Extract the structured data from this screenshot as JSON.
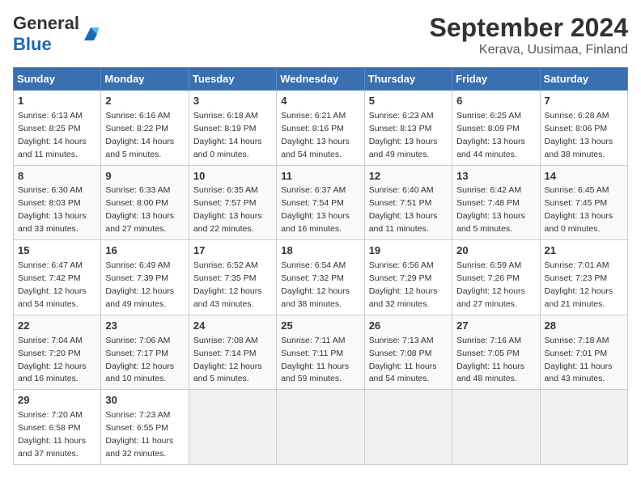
{
  "logo": {
    "general": "General",
    "blue": "Blue"
  },
  "title": "September 2024",
  "subtitle": "Kerava, Uusimaa, Finland",
  "days_of_week": [
    "Sunday",
    "Monday",
    "Tuesday",
    "Wednesday",
    "Thursday",
    "Friday",
    "Saturday"
  ],
  "weeks": [
    [
      {
        "day": "1",
        "sunrise": "6:13 AM",
        "sunset": "8:25 PM",
        "daylight": "14 hours and 11 minutes."
      },
      {
        "day": "2",
        "sunrise": "6:16 AM",
        "sunset": "8:22 PM",
        "daylight": "14 hours and 5 minutes."
      },
      {
        "day": "3",
        "sunrise": "6:18 AM",
        "sunset": "8:19 PM",
        "daylight": "14 hours and 0 minutes."
      },
      {
        "day": "4",
        "sunrise": "6:21 AM",
        "sunset": "8:16 PM",
        "daylight": "13 hours and 54 minutes."
      },
      {
        "day": "5",
        "sunrise": "6:23 AM",
        "sunset": "8:13 PM",
        "daylight": "13 hours and 49 minutes."
      },
      {
        "day": "6",
        "sunrise": "6:25 AM",
        "sunset": "8:09 PM",
        "daylight": "13 hours and 44 minutes."
      },
      {
        "day": "7",
        "sunrise": "6:28 AM",
        "sunset": "8:06 PM",
        "daylight": "13 hours and 38 minutes."
      }
    ],
    [
      {
        "day": "8",
        "sunrise": "6:30 AM",
        "sunset": "8:03 PM",
        "daylight": "13 hours and 33 minutes."
      },
      {
        "day": "9",
        "sunrise": "6:33 AM",
        "sunset": "8:00 PM",
        "daylight": "13 hours and 27 minutes."
      },
      {
        "day": "10",
        "sunrise": "6:35 AM",
        "sunset": "7:57 PM",
        "daylight": "13 hours and 22 minutes."
      },
      {
        "day": "11",
        "sunrise": "6:37 AM",
        "sunset": "7:54 PM",
        "daylight": "13 hours and 16 minutes."
      },
      {
        "day": "12",
        "sunrise": "6:40 AM",
        "sunset": "7:51 PM",
        "daylight": "13 hours and 11 minutes."
      },
      {
        "day": "13",
        "sunrise": "6:42 AM",
        "sunset": "7:48 PM",
        "daylight": "13 hours and 5 minutes."
      },
      {
        "day": "14",
        "sunrise": "6:45 AM",
        "sunset": "7:45 PM",
        "daylight": "13 hours and 0 minutes."
      }
    ],
    [
      {
        "day": "15",
        "sunrise": "6:47 AM",
        "sunset": "7:42 PM",
        "daylight": "12 hours and 54 minutes."
      },
      {
        "day": "16",
        "sunrise": "6:49 AM",
        "sunset": "7:39 PM",
        "daylight": "12 hours and 49 minutes."
      },
      {
        "day": "17",
        "sunrise": "6:52 AM",
        "sunset": "7:35 PM",
        "daylight": "12 hours and 43 minutes."
      },
      {
        "day": "18",
        "sunrise": "6:54 AM",
        "sunset": "7:32 PM",
        "daylight": "12 hours and 38 minutes."
      },
      {
        "day": "19",
        "sunrise": "6:56 AM",
        "sunset": "7:29 PM",
        "daylight": "12 hours and 32 minutes."
      },
      {
        "day": "20",
        "sunrise": "6:59 AM",
        "sunset": "7:26 PM",
        "daylight": "12 hours and 27 minutes."
      },
      {
        "day": "21",
        "sunrise": "7:01 AM",
        "sunset": "7:23 PM",
        "daylight": "12 hours and 21 minutes."
      }
    ],
    [
      {
        "day": "22",
        "sunrise": "7:04 AM",
        "sunset": "7:20 PM",
        "daylight": "12 hours and 16 minutes."
      },
      {
        "day": "23",
        "sunrise": "7:06 AM",
        "sunset": "7:17 PM",
        "daylight": "12 hours and 10 minutes."
      },
      {
        "day": "24",
        "sunrise": "7:08 AM",
        "sunset": "7:14 PM",
        "daylight": "12 hours and 5 minutes."
      },
      {
        "day": "25",
        "sunrise": "7:11 AM",
        "sunset": "7:11 PM",
        "daylight": "11 hours and 59 minutes."
      },
      {
        "day": "26",
        "sunrise": "7:13 AM",
        "sunset": "7:08 PM",
        "daylight": "11 hours and 54 minutes."
      },
      {
        "day": "27",
        "sunrise": "7:16 AM",
        "sunset": "7:05 PM",
        "daylight": "11 hours and 48 minutes."
      },
      {
        "day": "28",
        "sunrise": "7:18 AM",
        "sunset": "7:01 PM",
        "daylight": "11 hours and 43 minutes."
      }
    ],
    [
      {
        "day": "29",
        "sunrise": "7:20 AM",
        "sunset": "6:58 PM",
        "daylight": "11 hours and 37 minutes."
      },
      {
        "day": "30",
        "sunrise": "7:23 AM",
        "sunset": "6:55 PM",
        "daylight": "11 hours and 32 minutes."
      },
      null,
      null,
      null,
      null,
      null
    ]
  ]
}
